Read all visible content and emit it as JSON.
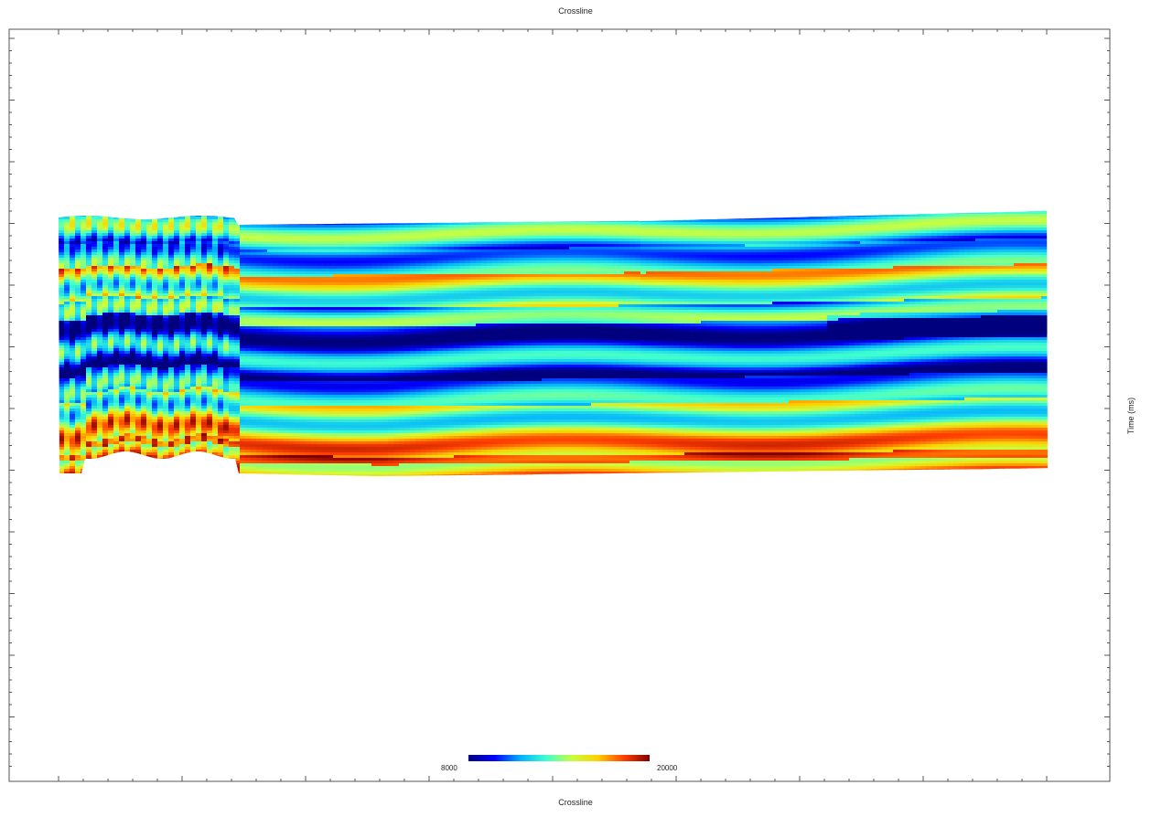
{
  "chart_data": {
    "type": "heatmap",
    "title": "Crossline",
    "xlabel": "Crossline",
    "ylabel": "Time (ms)",
    "colorbar": {
      "min_label": "8000",
      "max_label": "20000",
      "min": 8000,
      "max": 20000,
      "colormap": "jet",
      "colors": [
        "#00007f",
        "#0000ff",
        "#00b0ff",
        "#40ffd0",
        "#c8ff40",
        "#ffd000",
        "#ff4000",
        "#800000"
      ]
    },
    "grid": false,
    "legend_position": "bottom-center"
  }
}
